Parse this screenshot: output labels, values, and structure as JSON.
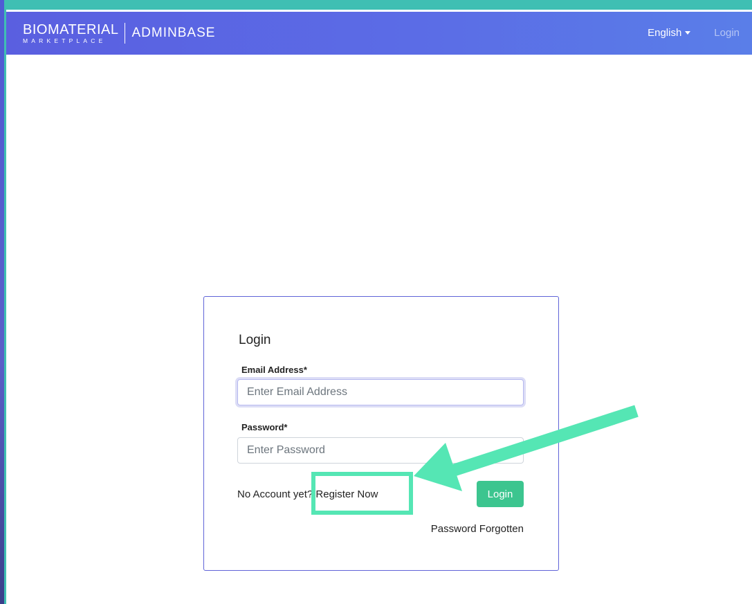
{
  "navbar": {
    "brand_name": "BIOMATERIAL",
    "brand_sub": "MARKETPLACE",
    "brand_admin": "ADMINBASE",
    "language_label": "English",
    "login_link": "Login"
  },
  "login_form": {
    "title": "Login",
    "email": {
      "label": "Email Address*",
      "placeholder": "Enter Email Address",
      "value": ""
    },
    "password": {
      "label": "Password*",
      "placeholder": "Enter Password",
      "value": ""
    },
    "register_prompt": "No Account yet?",
    "register_link": "Register Now",
    "submit_label": "Login",
    "forgot_label": "Password Forgotten"
  },
  "colors": {
    "navbar_start": "#5a5fe0",
    "navbar_end": "#5a7ee8",
    "accent_green": "#3cc58f",
    "annotation": "#55e6b4",
    "card_border": "#5f63d8"
  }
}
